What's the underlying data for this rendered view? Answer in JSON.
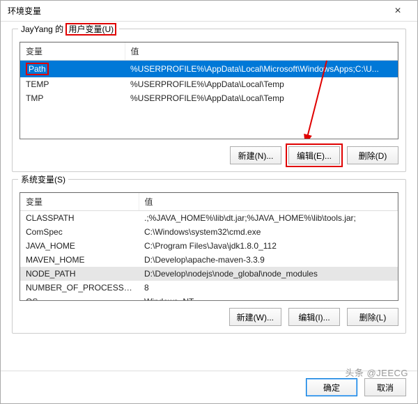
{
  "window": {
    "title": "环境变量",
    "close_icon": "×"
  },
  "user_group": {
    "prefix": "JayYang 的 ",
    "label_highlight": "用户变量(U)",
    "columns": {
      "name": "变量",
      "value": "值"
    },
    "rows": [
      {
        "name": "Path",
        "value": "%USERPROFILE%\\AppData\\Local\\Microsoft\\WindowsApps;C:\\U...",
        "selected": true,
        "name_highlight": true
      },
      {
        "name": "TEMP",
        "value": "%USERPROFILE%\\AppData\\Local\\Temp"
      },
      {
        "name": "TMP",
        "value": "%USERPROFILE%\\AppData\\Local\\Temp"
      }
    ],
    "buttons": {
      "new": "新建(N)...",
      "edit": "编辑(E)...",
      "delete": "删除(D)"
    }
  },
  "system_group": {
    "label": "系统变量(S)",
    "columns": {
      "name": "变量",
      "value": "值"
    },
    "rows": [
      {
        "name": "CLASSPATH",
        "value": ".;%JAVA_HOME%\\lib\\dt.jar;%JAVA_HOME%\\lib\\tools.jar;"
      },
      {
        "name": "ComSpec",
        "value": "C:\\Windows\\system32\\cmd.exe"
      },
      {
        "name": "JAVA_HOME",
        "value": "C:\\Program Files\\Java\\jdk1.8.0_112"
      },
      {
        "name": "MAVEN_HOME",
        "value": "D:\\Develop\\apache-maven-3.3.9"
      },
      {
        "name": "NODE_PATH",
        "value": "D:\\Develop\\nodejs\\node_global\\node_modules",
        "syssel": true
      },
      {
        "name": "NUMBER_OF_PROCESSORS",
        "value": "8"
      },
      {
        "name": "OS",
        "value": "Windows_NT"
      }
    ],
    "buttons": {
      "new": "新建(W)...",
      "edit": "编辑(I)...",
      "delete": "删除(L)"
    }
  },
  "footer": {
    "ok": "确定",
    "cancel": "取消"
  },
  "watermark": "头条 @JEECG"
}
